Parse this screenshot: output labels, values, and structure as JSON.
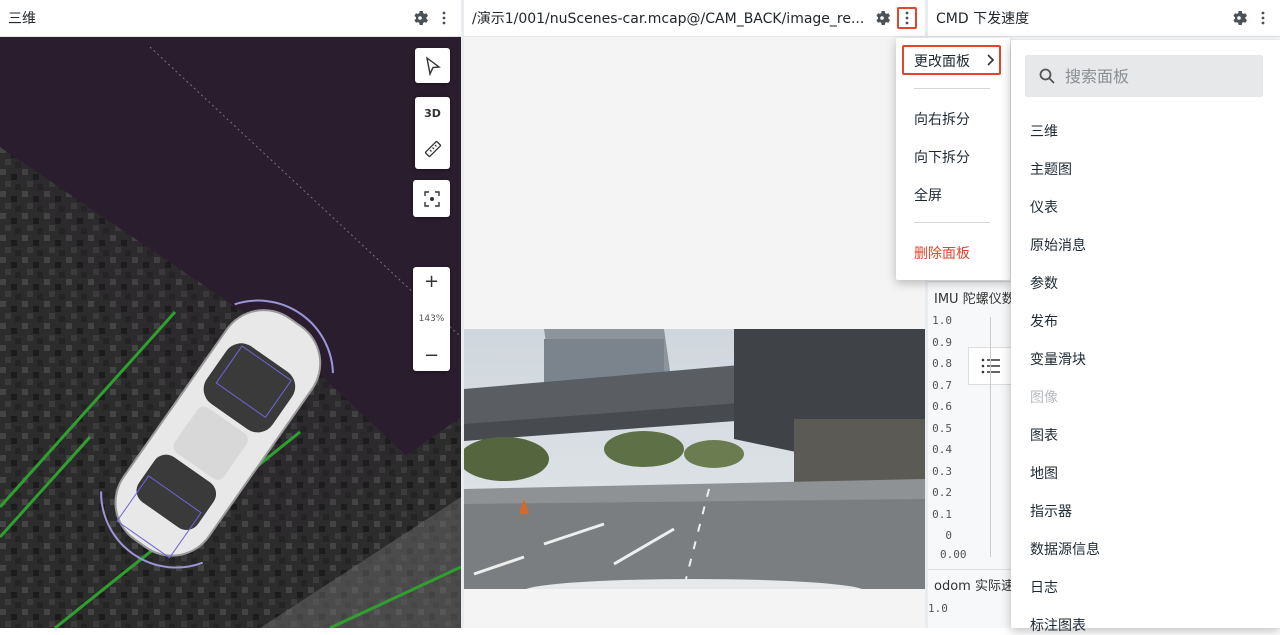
{
  "panels": {
    "three_d": {
      "title": "三维"
    },
    "image": {
      "title": "/演示1/001/nuScenes-car.mcap@/CAM_BACK/image_re..."
    },
    "cmd": {
      "title": "CMD 下发速度"
    }
  },
  "toolbar_3d": {
    "mode_3d": "3D",
    "zoom_level": "143%",
    "zoom_in": "+",
    "zoom_out": "−"
  },
  "plots": {
    "imu_title": "IMU 陀螺仪数",
    "odom_title": "odom 实际速",
    "y_ticks": [
      "1.0",
      "0.9",
      "0.8",
      "0.7",
      "0.6",
      "0.5",
      "0.4",
      "0.3",
      "0.2",
      "0.1",
      "0"
    ],
    "x_tick": "0.00",
    "odom_tick": "1.0"
  },
  "context_menu": {
    "change_panel": "更改面板",
    "split_right": "向右拆分",
    "split_down": "向下拆分",
    "fullscreen": "全屏",
    "delete_panel": "删除面板"
  },
  "submenu": {
    "search_placeholder": "搜索面板",
    "items": [
      "三维",
      "主题图",
      "仪表",
      "原始消息",
      "参数",
      "发布",
      "变量滑块",
      "图像",
      "图表",
      "地图",
      "指示器",
      "数据源信息",
      "日志",
      "标注图表"
    ],
    "disabled_item": "图像"
  },
  "colors": {
    "danger": "#e2452b",
    "lane_green": "#2fa02f",
    "scene_bg": "#2a1d2d"
  }
}
